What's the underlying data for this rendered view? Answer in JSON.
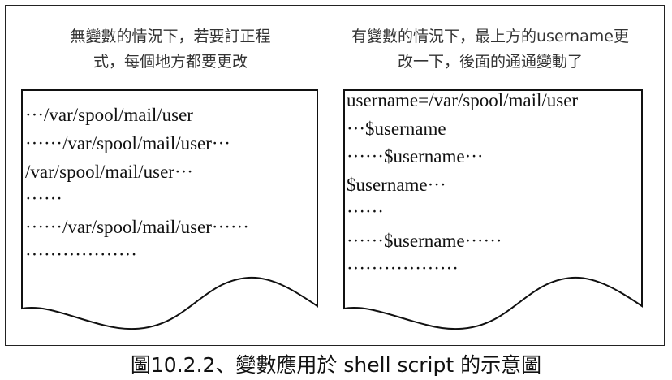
{
  "left_panel": {
    "heading": [
      "無變數的情況下，若要訂正程",
      "式，每個地方都要更改"
    ],
    "lines": [
      "···/var/spool/mail/user",
      "······/var/spool/mail/user···",
      "/var/spool/mail/user···",
      "······",
      "······/var/spool/mail/user······",
      "··················"
    ]
  },
  "right_panel": {
    "heading": [
      "有變數的情況下，最上方的username更",
      "改一下，後面的通通變動了"
    ],
    "lines": [
      "username=/var/spool/mail/user",
      "···$username",
      "······$username···",
      "$username···",
      "······",
      "······$username······",
      "··················"
    ]
  },
  "caption": "圖10.2.2、變數應用於 shell script 的示意圖"
}
